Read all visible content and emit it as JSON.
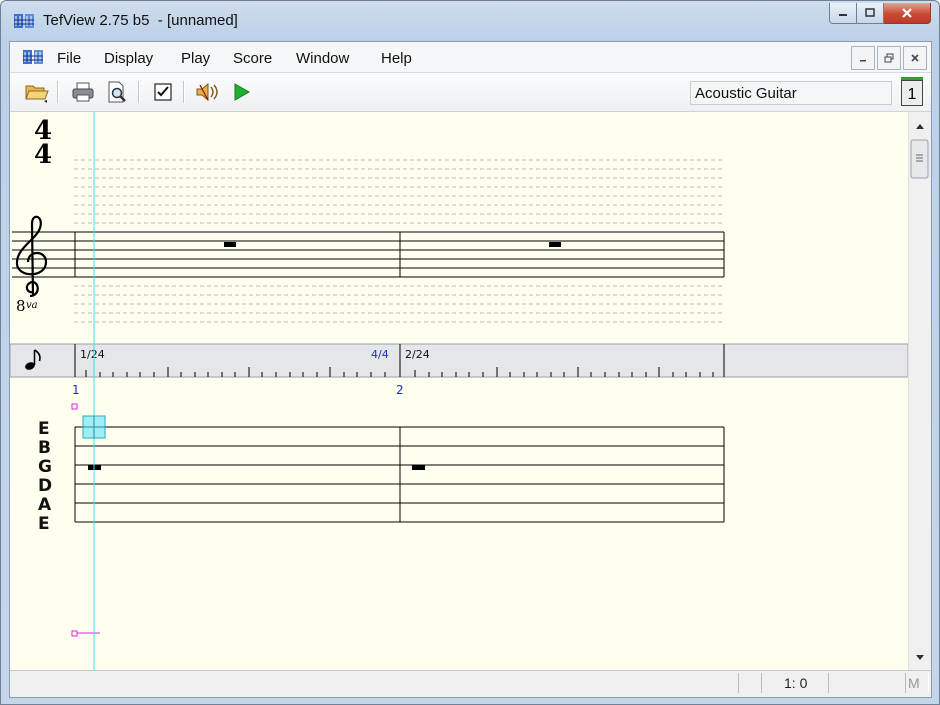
{
  "window": {
    "title": "TefView 2.75 b5  - [unnamed]"
  },
  "menu": {
    "items": [
      "File",
      "Display",
      "Play",
      "Score",
      "Window",
      "Help"
    ]
  },
  "toolbar": {
    "instrument": "Acoustic Guitar",
    "track_number": "1"
  },
  "score": {
    "time_signature_top": "4",
    "time_signature_bottom": "4",
    "octave_marker": "8",
    "octave_marker_sup": "va",
    "ruler_labels": [
      "1/24",
      "4/4",
      "2/24"
    ],
    "measure_numbers": [
      "1",
      "2"
    ],
    "string_names": [
      "E",
      "B",
      "G",
      "D",
      "A",
      "E"
    ]
  },
  "status": {
    "position": "1: 0",
    "mode": "M"
  },
  "colors": {
    "paper": "#fffff0",
    "cursor": "#40e0e8",
    "marker": "#e020e0",
    "ruler_blue": "#1a2ed0",
    "play_green": "#22b030"
  }
}
